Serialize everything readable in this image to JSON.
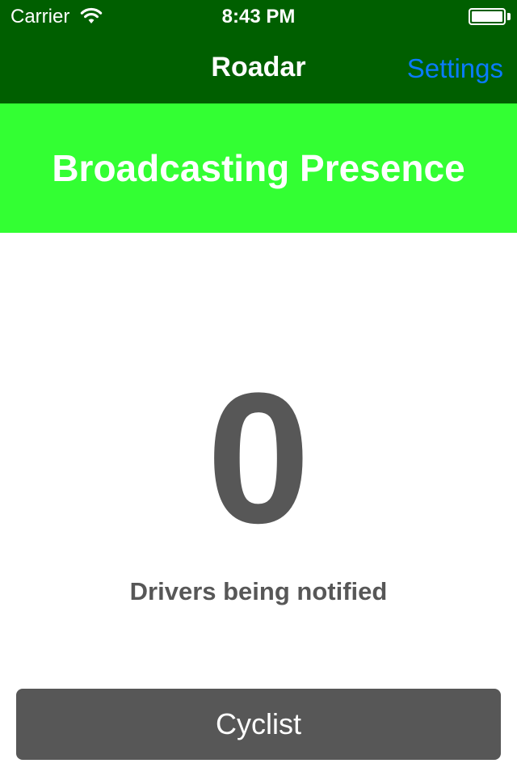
{
  "status_bar": {
    "carrier": "Carrier",
    "time": "8:43 PM",
    "wifi_icon": "wifi-icon",
    "battery_icon": "battery-icon"
  },
  "nav": {
    "title": "Roadar",
    "settings_label": "Settings"
  },
  "status": {
    "text": "Broadcasting Presence",
    "color": "#33ff33"
  },
  "drivers": {
    "count": "0",
    "caption": "Drivers being notified"
  },
  "mode_button": {
    "label": "Cyclist"
  },
  "colors": {
    "nav_background": "#005f00",
    "accent_link": "#0a7bff",
    "text_gray": "#575757"
  }
}
